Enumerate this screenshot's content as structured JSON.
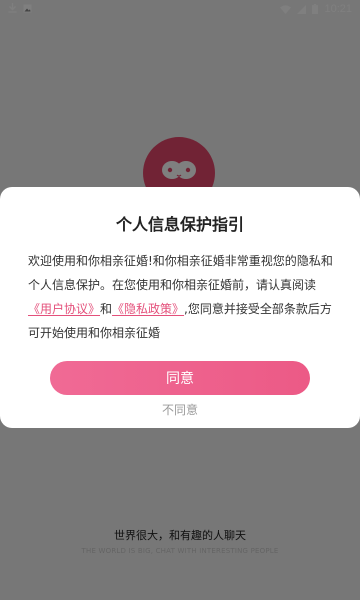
{
  "status_bar": {
    "time": "10:21"
  },
  "splash": {
    "tagline": "世界很大，和有趣的人聊天",
    "tagline_en": "THE WORLD IS BIG, CHAT WITH INTERESTING PEOPLE"
  },
  "dialog": {
    "title": "个人信息保护指引",
    "body_part1": "欢迎使用和你相亲征婚!和你相亲征婚非常重视您的隐私和个人信息保护。在您使用和你相亲征婚前，请认真阅读",
    "user_agreement": "《用户协议》",
    "and": "和",
    "privacy_policy": "《隐私政策》",
    "body_part2": ",您同意并接受全部条款后方可开始使用和你相亲征婚",
    "agree_label": "同意",
    "disagree_label": "不同意"
  },
  "colors": {
    "accent": "#ec5a86",
    "logo": "#e2476a"
  }
}
